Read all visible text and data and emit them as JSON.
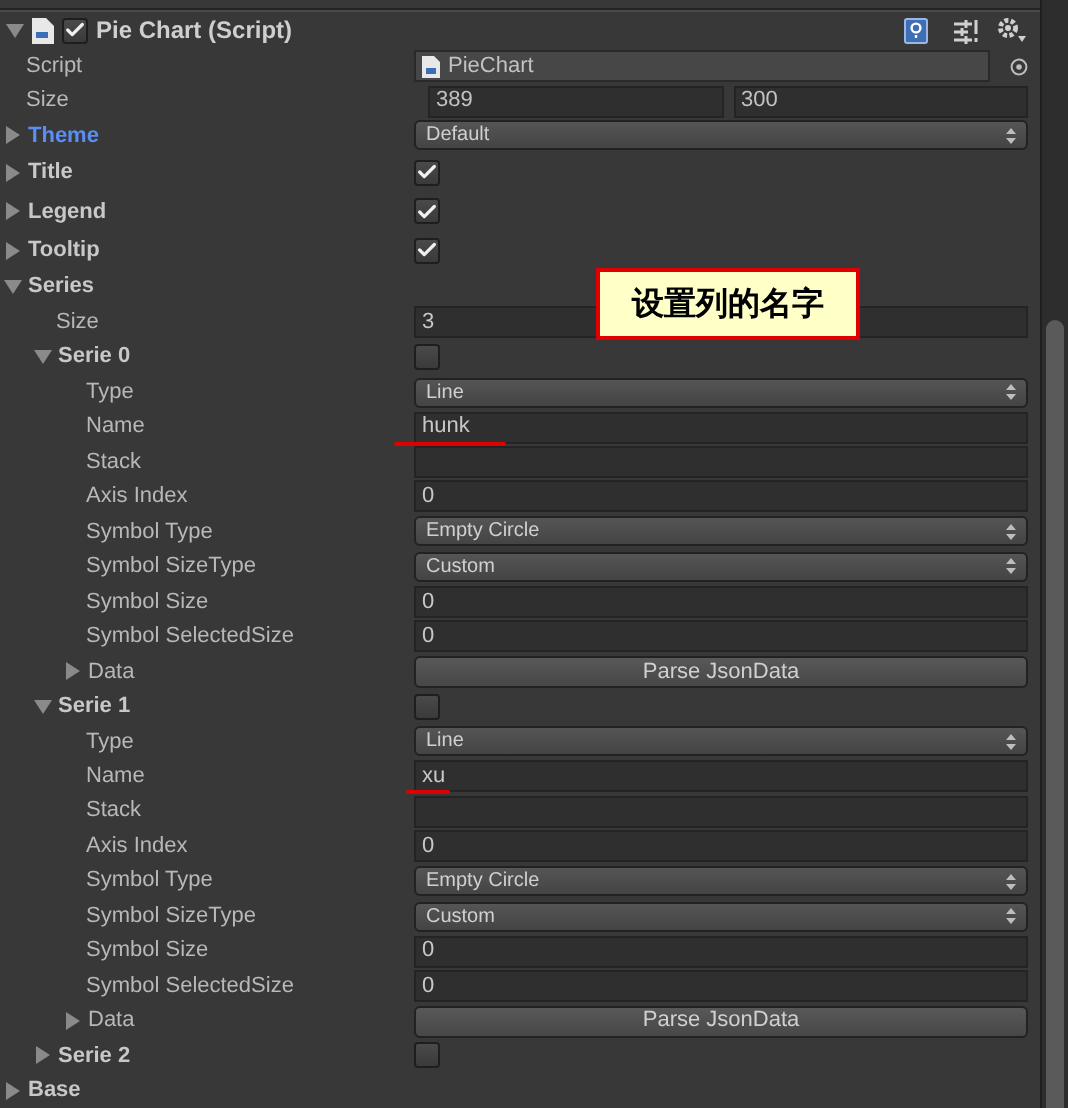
{
  "component": {
    "title": "Pie Chart (Script)",
    "enabled": true,
    "expanded": true
  },
  "properties": [
    {
      "kind": "object",
      "label": "Script",
      "value": "PieChart"
    },
    {
      "kind": "vector2",
      "label": "Size",
      "values": [
        "389",
        "300"
      ]
    },
    {
      "kind": "dropdown",
      "label": "Theme",
      "value": "Default",
      "expanded": false,
      "highlighted": true
    },
    {
      "kind": "toggle",
      "label": "Title",
      "expanded": false,
      "checked": true
    },
    {
      "kind": "toggle",
      "label": "Legend",
      "expanded": false,
      "checked": true
    },
    {
      "kind": "toggle",
      "label": "Tooltip",
      "expanded": false,
      "checked": true
    },
    {
      "kind": "group",
      "label": "Series",
      "expanded": true,
      "children": [
        {
          "kind": "text",
          "label": "Size",
          "value": "3"
        },
        {
          "kind": "toggle",
          "label": "Serie 0",
          "expanded": true,
          "checked": false,
          "children": [
            {
              "kind": "dropdown",
              "label": "Type",
              "value": "Line"
            },
            {
              "kind": "text",
              "label": "Name",
              "value": "hunk",
              "underlined": true
            },
            {
              "kind": "text",
              "label": "Stack"
            },
            {
              "kind": "text",
              "label": "Axis Index",
              "value": "0"
            },
            {
              "kind": "dropdown",
              "label": "Symbol Type",
              "value": "Empty Circle"
            },
            {
              "kind": "dropdown",
              "label": "Symbol SizeType",
              "value": "Custom"
            },
            {
              "kind": "text",
              "label": "Symbol Size",
              "value": "0"
            },
            {
              "kind": "text",
              "label": "Symbol SelectedSize",
              "value": "0"
            },
            {
              "kind": "button",
              "label": "Data",
              "expanded": false,
              "value": "Parse JsonData"
            }
          ]
        },
        {
          "kind": "toggle",
          "label": "Serie 1",
          "expanded": true,
          "checked": false,
          "children": [
            {
              "kind": "dropdown",
              "label": "Type",
              "value": "Line"
            },
            {
              "kind": "text",
              "label": "Name",
              "value": "xu",
              "underlined": true
            },
            {
              "kind": "text",
              "label": "Stack"
            },
            {
              "kind": "text",
              "label": "Axis Index",
              "value": "0"
            },
            {
              "kind": "dropdown",
              "label": "Symbol Type",
              "value": "Empty Circle"
            },
            {
              "kind": "dropdown",
              "label": "Symbol SizeType",
              "value": "Custom"
            },
            {
              "kind": "text",
              "label": "Symbol Size",
              "value": "0"
            },
            {
              "kind": "text",
              "label": "Symbol SelectedSize",
              "value": "0"
            },
            {
              "kind": "button",
              "label": "Data",
              "expanded": false,
              "value": "Parse JsonData"
            }
          ]
        },
        {
          "kind": "toggle",
          "label": "Serie 2",
          "expanded": false,
          "checked": false
        }
      ]
    },
    {
      "kind": "group",
      "label": "Base",
      "expanded": false
    }
  ],
  "annotation": {
    "text": "设置列的名字"
  }
}
